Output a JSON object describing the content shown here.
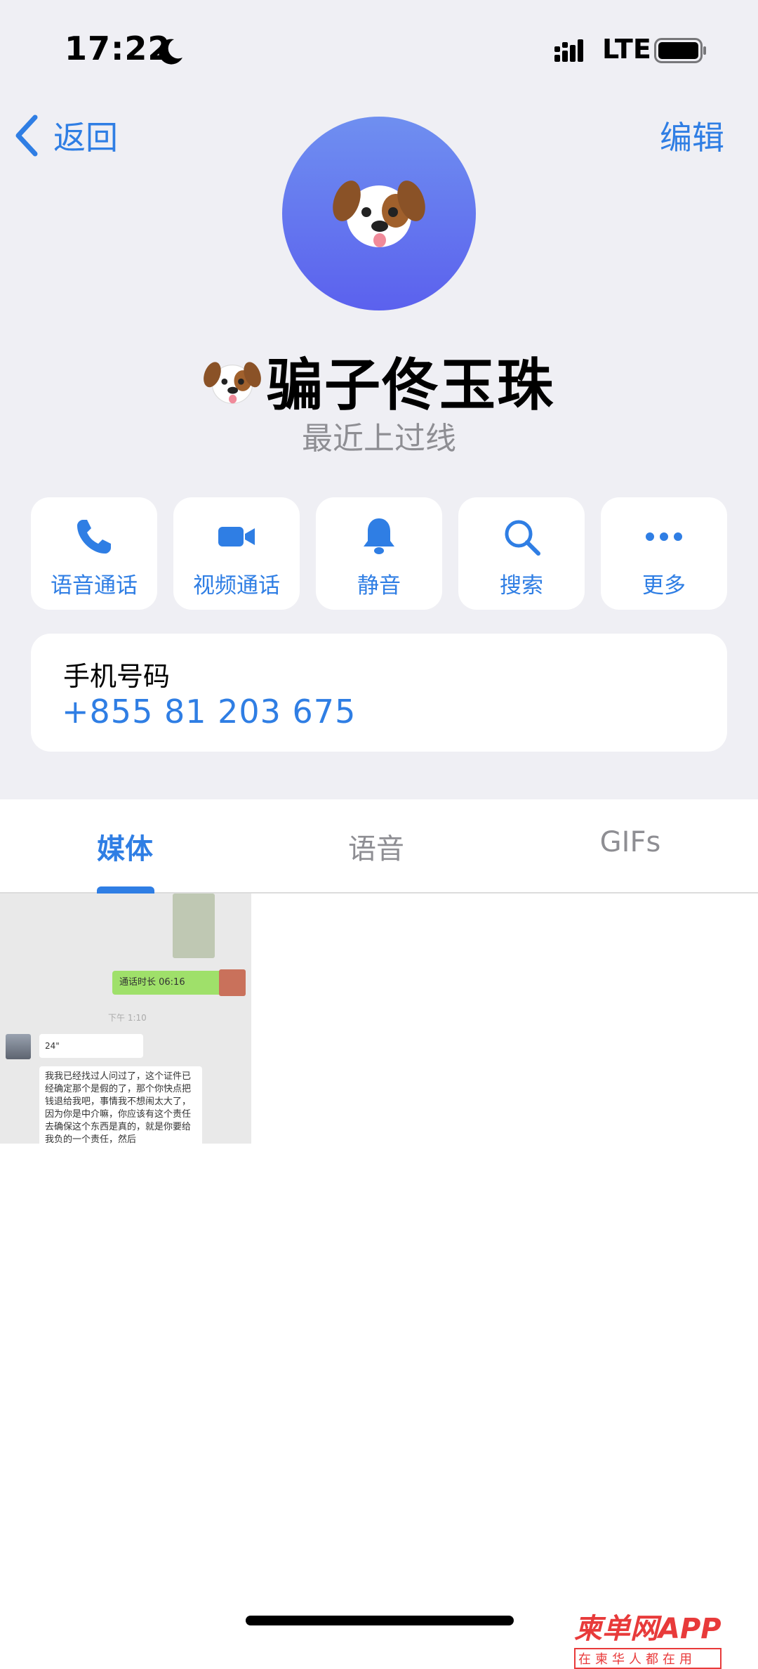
{
  "status_bar": {
    "time": "17:22",
    "network": "LTE"
  },
  "nav": {
    "back_label": "返回",
    "edit_label": "编辑"
  },
  "contact": {
    "name": "骗子佟玉珠",
    "status": "最近上过线"
  },
  "actions": [
    {
      "label": "语音通话",
      "icon": "phone-icon"
    },
    {
      "label": "视频通话",
      "icon": "video-icon"
    },
    {
      "label": "静音",
      "icon": "bell-icon"
    },
    {
      "label": "搜索",
      "icon": "search-icon"
    },
    {
      "label": "更多",
      "icon": "more-icon"
    }
  ],
  "phone": {
    "label": "手机号码",
    "value": "+855 81 203 675"
  },
  "tabs": [
    {
      "label": "媒体",
      "active": true
    },
    {
      "label": "语音",
      "active": false
    },
    {
      "label": "GIFs",
      "active": false
    }
  ],
  "media": {
    "call_duration": "通话时长 06:16",
    "chat_time": "下午 1:10",
    "voice_length": "24\"",
    "message_text": "我我已经找过人问过了，这个证件已经确定那个是假的了，那个你快点把钱退给我吧，事情我不想闹太大了，因为你是中介嘛，你应该有这个责任去确保这个东西是真的，就是你要给我负的一个责任，然后"
  },
  "watermark": {
    "main": "柬单网APP",
    "sub": "在柬华人都在用"
  },
  "colors": {
    "accent": "#2f7ee4",
    "background": "#efeff4",
    "avatar_gradient_start": "#6f8ff0",
    "avatar_gradient_end": "#5b61ee"
  }
}
